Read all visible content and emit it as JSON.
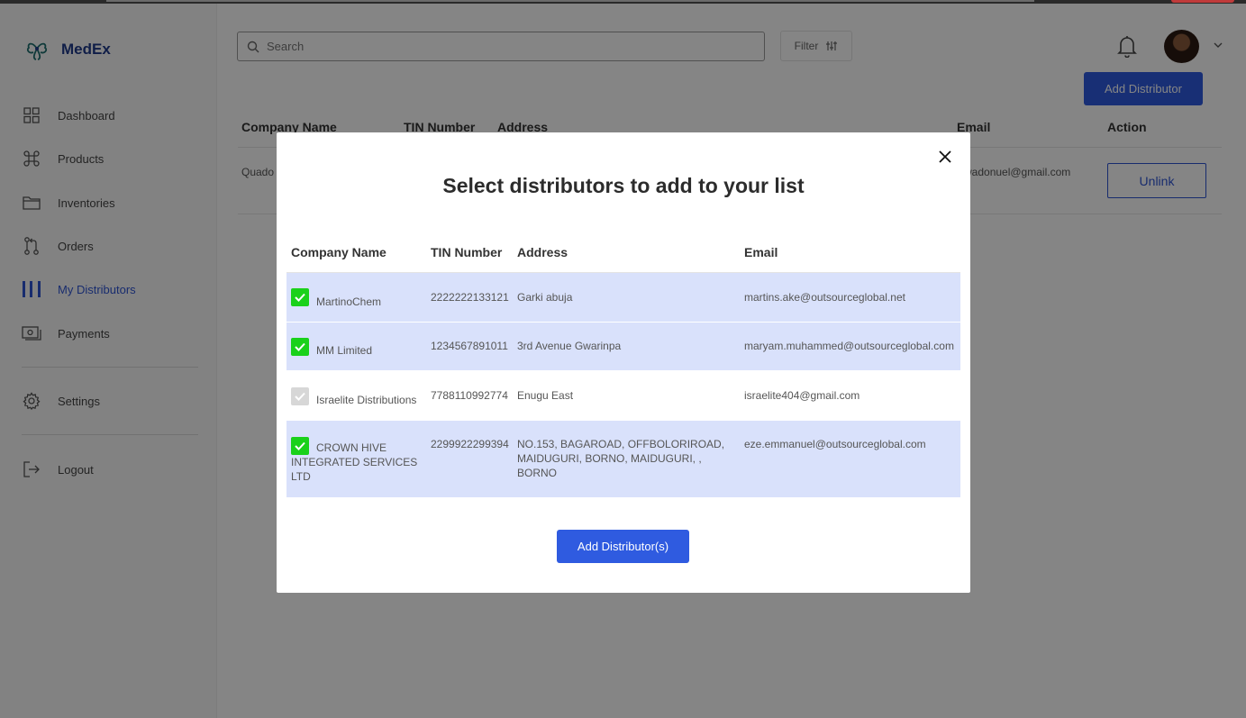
{
  "app": {
    "name": "MedEx"
  },
  "sidebar": {
    "items": [
      {
        "label": "Dashboard",
        "icon": "grid-icon"
      },
      {
        "label": "Products",
        "icon": "command-icon"
      },
      {
        "label": "Inventories",
        "icon": "folder-icon"
      },
      {
        "label": "Orders",
        "icon": "git-pull-icon"
      },
      {
        "label": "My Distributors",
        "icon": "columns-icon",
        "active": true
      },
      {
        "label": "Payments",
        "icon": "cash-icon"
      },
      {
        "label": "Settings",
        "icon": "gear-icon"
      },
      {
        "label": "Logout",
        "icon": "logout-icon"
      }
    ]
  },
  "header": {
    "search_placeholder": "Search",
    "filter_label": "Filter"
  },
  "page": {
    "add_button": "Add Distributor",
    "columns": [
      "Company Name",
      "TIN Number",
      "Address",
      "Email",
      "Action"
    ],
    "rows": [
      {
        "company": "Quado",
        "email": "kwadonuel@gmail.com",
        "action": "Unlink"
      }
    ]
  },
  "modal": {
    "title": "Select distributors to add to your list",
    "columns": [
      "Company Name",
      "TIN Number",
      "Address",
      "Email"
    ],
    "rows": [
      {
        "checked": true,
        "company": "MartinoChem",
        "tin": "2222222133121",
        "address": "Garki abuja",
        "email": "martins.ake@outsourceglobal.net"
      },
      {
        "checked": true,
        "company": "MM Limited",
        "tin": "1234567891011",
        "address": "3rd Avenue Gwarinpa",
        "email": "maryam.muhammed@outsourceglobal.com"
      },
      {
        "checked": false,
        "company": "Israelite Distributions",
        "tin": "7788110992774",
        "address": "Enugu East",
        "email": "israelite404@gmail.com"
      },
      {
        "checked": true,
        "company": "CROWN HIVE INTEGRATED SERVICES LTD",
        "tin": "2299922299394",
        "address": "NO.153, BAGAROAD, OFFBOLORIROAD, MAIDUGURI, BORNO, MAIDUGURI, , BORNO",
        "email": "eze.emmanuel@outsourceglobal.com"
      }
    ],
    "submit_label": "Add Distributor(s)"
  },
  "colors": {
    "primary": "#2f5be0",
    "brand": "#1f3a8a",
    "checkbox_on": "#1ad11a",
    "row_selected": "#d9e1fb"
  }
}
